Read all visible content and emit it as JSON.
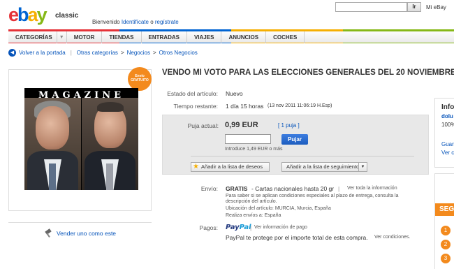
{
  "header": {
    "logo_text": "ebay",
    "logo_sub": "classic",
    "welcome_prefix": "Bienvenido",
    "signin": "Identifícate",
    "or": "o",
    "register": "regístrate",
    "search_button": "Ir",
    "my_ebay": "Mi eBay"
  },
  "nav": {
    "items": [
      "CATEGORÍAS",
      "MOTOR",
      "TIENDAS",
      "ENTRADAS",
      "VIAJES",
      "ANUNCIOS",
      "COCHES"
    ]
  },
  "breadcrumb": {
    "back": "Volver a la portada",
    "path": [
      "Otras categorías",
      "Negocios",
      "Otros Negocios"
    ]
  },
  "image_panel": {
    "badge": "Envío GRATUITO",
    "magazine_title": "MAGAZINE"
  },
  "sell": "Vender uno como este",
  "item": {
    "title": "VENDO MI VOTO PARA LAS ELECCIONES GENERALES DEL 20 NOVIEMBRE",
    "condition_label": "Estado del artículo:",
    "condition_value": "Nuevo",
    "time_label": "Tiempo restante:",
    "time_value": "1 día 15 horas",
    "time_detail": "(13 nov 2011 11:06:19 H.Esp)",
    "price_label": "Puja actual:",
    "price_value": "0,99 EUR",
    "bids": "[ 1 puja ]",
    "bid_button": "Pujar",
    "bid_hint": "Introduce 1,49 EUR o más",
    "wishlist": "Añadir a la lista de deseos",
    "watchlist": "Añadir a la lista de seguimiento",
    "shipping_label": "Envío:",
    "shipping_free": "GRATIS",
    "shipping_detail": "- Cartas nacionales hasta 20 gr",
    "shipping_link": "Ver toda la información",
    "shipping_note1": "Para saber si se aplican condiciones especiales al plazo de entrega, consulta la",
    "shipping_note2": "descripción del artículo.",
    "location": "Ubicación del artículo: MURCIA, Murcia, España",
    "ships_to": "Realiza envíos a: España",
    "payments_label": "Pagos:",
    "paypal_a": "Pay",
    "paypal_b": "Pal",
    "payments_link": "Ver información de pago",
    "paypal_protect": "PayPal te protege por el importe total de esta compra.",
    "conditions_link": "Ver condiciones."
  },
  "seller": {
    "header": "Info",
    "name": "dolu",
    "feedback": "100%",
    "save": "Guar",
    "see": "Ver c"
  },
  "promo": {
    "stripe": "SEG",
    "dots": [
      "1",
      "2",
      "3"
    ]
  }
}
